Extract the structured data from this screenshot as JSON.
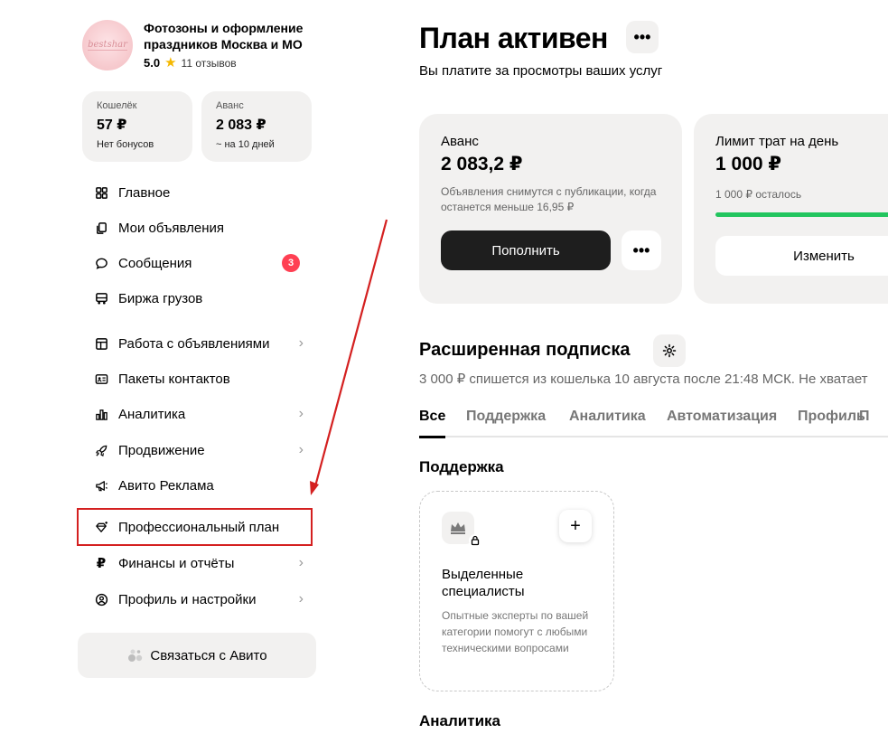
{
  "profile": {
    "name": "Фотозоны и оформление праздников Москва и МО",
    "rating": "5.0",
    "reviews": "11 отзывов",
    "avatar_text": "bestshar"
  },
  "wallet": {
    "label": "Кошелёк",
    "value": "57 ₽",
    "sub": "Нет бонусов"
  },
  "advance": {
    "label": "Аванс",
    "value": "2 083 ₽",
    "sub": "~ на 10 дней"
  },
  "nav": {
    "main": "Главное",
    "my_ads": "Мои объявления",
    "messages": "Сообщения",
    "messages_badge": "3",
    "cargo": "Биржа грузов",
    "ads_work": "Работа с объявлениями",
    "contacts": "Пакеты контактов",
    "analytics": "Аналитика",
    "promotion": "Продвижение",
    "avito_ads": "Авито Реклама",
    "pro_plan": "Профессиональный план",
    "finance": "Финансы и отчёты",
    "profile": "Профиль и настройки"
  },
  "contact_button": "Связаться с Авито",
  "main": {
    "title": "План активен",
    "subtitle": "Вы платите за просмотры ваших услуг",
    "more_label": "•••"
  },
  "advance_card": {
    "label": "Аванс",
    "value": "2 083,2 ₽",
    "note": "Объявления снимутся с публикации, когда останется меньше 16,95 ₽",
    "button": "Пополнить",
    "more_label": "•••"
  },
  "limit_card": {
    "label": "Лимит трат на день",
    "value": "1 000 ₽",
    "left": "1 000 ₽ осталось",
    "progress_percent": 100,
    "button": "Изменить"
  },
  "subscription": {
    "title": "Расширенная подписка",
    "note": "3 000 ₽ спишется из кошелька 10 августа после 21:48  МСК. Не хватает"
  },
  "tabs": [
    "Все",
    "Поддержка",
    "Аналитика",
    "Автоматизация",
    "Профиль",
    "П"
  ],
  "support_section": {
    "title": "Поддержка",
    "feature_title": "Выделенные специалисты",
    "feature_desc": "Опытные эксперты по вашей категории помогут с любыми техническими вопросами",
    "plus_label": "+"
  },
  "analytics_section": {
    "title": "Аналитика"
  },
  "colors": {
    "accent_red": "#d42020",
    "badge_red": "#ff4053",
    "progress_green": "#22c55e",
    "card_bg": "#f2f1f0"
  }
}
